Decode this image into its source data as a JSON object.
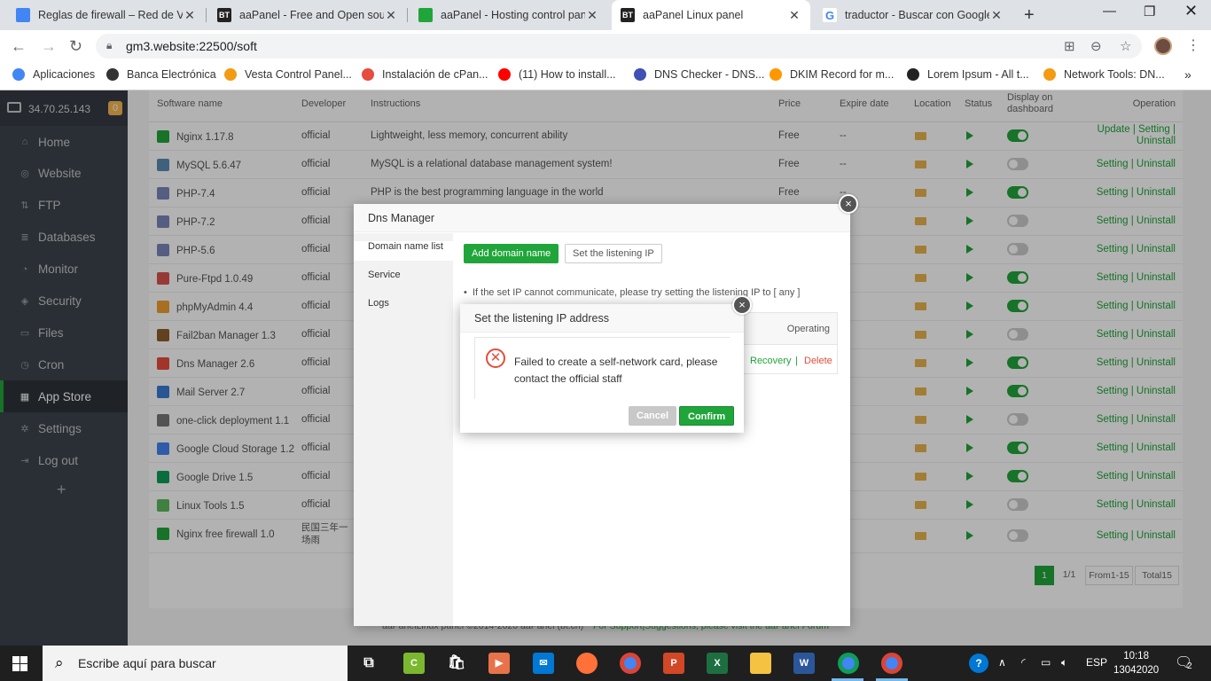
{
  "browser": {
    "tabs": [
      {
        "title": "Reglas de firewall – Red de VPC",
        "favicon_color": "#4285f4",
        "favicon_text": "",
        "active": false
      },
      {
        "title": "aaPanel - Free and Open source",
        "favicon_color": "#222222",
        "favicon_text": "BT",
        "active": false
      },
      {
        "title": "aaPanel - Hosting control panel",
        "favicon_color": "#20a53a",
        "favicon_text": "",
        "active": false
      },
      {
        "title": "aaPanel Linux panel",
        "favicon_color": "#222222",
        "favicon_text": "BT",
        "active": true
      },
      {
        "title": "traductor - Buscar con Google",
        "favicon_color": "#ffffff",
        "favicon_text": "G",
        "active": false
      }
    ],
    "url": "gm3.website:22500/soft",
    "bookmarks": [
      {
        "label": "Aplicaciones",
        "color": "#4285f4"
      },
      {
        "label": "Banca Electrónica",
        "color": "#333333"
      },
      {
        "label": "Vesta Control Panel...",
        "color": "#f39c12"
      },
      {
        "label": "Instalación de cPan...",
        "color": "#e74c3c"
      },
      {
        "label": "(11) How to install...",
        "color": "#ff0000"
      },
      {
        "label": "DNS Checker - DNS...",
        "color": "#3f51b5"
      },
      {
        "label": "DKIM Record for m...",
        "color": "#ff9800"
      },
      {
        "label": "Lorem Ipsum - All t...",
        "color": "#222222"
      },
      {
        "label": "Network Tools: DN...",
        "color": "#f39c12"
      }
    ]
  },
  "sidebar": {
    "ip": "34.70.25.143",
    "badge": "0",
    "items": [
      {
        "label": "Home",
        "icon": "home-icon",
        "glyph": "⌂"
      },
      {
        "label": "Website",
        "icon": "globe-icon",
        "glyph": "◎"
      },
      {
        "label": "FTP",
        "icon": "ftp-icon",
        "glyph": "⇅"
      },
      {
        "label": "Databases",
        "icon": "database-icon",
        "glyph": "≣"
      },
      {
        "label": "Monitor",
        "icon": "monitor-icon",
        "glyph": "◔"
      },
      {
        "label": "Security",
        "icon": "shield-icon",
        "glyph": "◈"
      },
      {
        "label": "Files",
        "icon": "folder-icon",
        "glyph": "▭"
      },
      {
        "label": "Cron",
        "icon": "clock-icon",
        "glyph": "◷"
      },
      {
        "label": "App Store",
        "icon": "grid-icon",
        "glyph": "▦"
      },
      {
        "label": "Settings",
        "icon": "gear-icon",
        "glyph": "✲"
      },
      {
        "label": "Log out",
        "icon": "logout-icon",
        "glyph": "⇥"
      }
    ],
    "active_index": 8,
    "add_label": "+"
  },
  "table": {
    "headers": {
      "name": "Software name",
      "developer": "Developer",
      "instructions": "Instructions",
      "price": "Price",
      "expire": "Expire date",
      "location": "Location",
      "status": "Status",
      "display": "Display on dashboard",
      "operation": "Operation"
    },
    "rows": [
      {
        "name": "Nginx 1.17.8",
        "developer": "official",
        "instructions": "Lightweight, less memory, concurrent ability",
        "price": "Free",
        "expire": "--",
        "display_on": true,
        "ops": "Update | Setting | Uninstall",
        "icon_color": "#20a53a"
      },
      {
        "name": "MySQL 5.6.47",
        "developer": "official",
        "instructions": "MySQL is a relational database management system!",
        "price": "Free",
        "expire": "--",
        "display_on": false,
        "ops": "Setting | Uninstall",
        "icon_color": "#5b8bb5"
      },
      {
        "name": "PHP-7.4",
        "developer": "official",
        "instructions": "PHP is the best programming language in the world",
        "price": "Free",
        "expire": "--",
        "display_on": true,
        "ops": "Setting | Uninstall",
        "icon_color": "#7a86b8"
      },
      {
        "name": "PHP-7.2",
        "developer": "official",
        "instructions": "",
        "price": "",
        "expire": "",
        "display_on": false,
        "ops": "Setting | Uninstall",
        "icon_color": "#7a86b8"
      },
      {
        "name": "PHP-5.6",
        "developer": "official",
        "instructions": "",
        "price": "",
        "expire": "",
        "display_on": false,
        "ops": "Setting | Uninstall",
        "icon_color": "#7a86b8"
      },
      {
        "name": "Pure-Ftpd 1.0.49",
        "developer": "official",
        "instructions": "",
        "price": "",
        "expire": "",
        "display_on": true,
        "ops": "Setting | Uninstall",
        "icon_color": "#d9534f"
      },
      {
        "name": "phpMyAdmin 4.4",
        "developer": "official",
        "instructions": "",
        "price": "",
        "expire": "",
        "display_on": true,
        "ops": "Setting | Uninstall",
        "icon_color": "#f0a030"
      },
      {
        "name": "Fail2ban Manager 1.3",
        "developer": "official",
        "instructions": "",
        "price": "",
        "expire": "",
        "display_on": false,
        "ops": "Setting | Uninstall",
        "icon_color": "#8b5e2b"
      },
      {
        "name": "Dns Manager 2.6",
        "developer": "official",
        "instructions": "",
        "price": "",
        "expire": "",
        "display_on": true,
        "ops": "Setting | Uninstall",
        "icon_color": "#e74c3c"
      },
      {
        "name": "Mail Server 2.7",
        "developer": "official",
        "instructions": "",
        "price": "",
        "expire": "",
        "display_on": true,
        "ops": "Setting | Uninstall",
        "icon_color": "#3a7bd5"
      },
      {
        "name": "one-click deployment 1.1",
        "developer": "official",
        "instructions": "",
        "price": "",
        "expire": "",
        "display_on": false,
        "ops": "Setting | Uninstall",
        "icon_color": "#777777"
      },
      {
        "name": "Google Cloud Storage 1.2",
        "developer": "official",
        "instructions": "",
        "price": "",
        "expire": "",
        "display_on": true,
        "ops": "Setting | Uninstall",
        "icon_color": "#4285f4"
      },
      {
        "name": "Google Drive 1.5",
        "developer": "official",
        "instructions": "",
        "price": "",
        "expire": "",
        "display_on": true,
        "ops": "Setting | Uninstall",
        "icon_color": "#0f9d58"
      },
      {
        "name": "Linux Tools 1.5",
        "developer": "official",
        "instructions": "",
        "price": "",
        "expire": "",
        "display_on": false,
        "ops": "Setting | Uninstall",
        "icon_color": "#5cb85c"
      },
      {
        "name": "Nginx free firewall 1.0",
        "developer": "民国三年一场雨",
        "instructions": "",
        "price": "",
        "expire": "",
        "display_on": false,
        "ops": "Setting | Uninstall",
        "icon_color": "#20a53a"
      }
    ],
    "pager": {
      "current": "1",
      "pages": "1/1",
      "range": "From1-15",
      "total": "Total15"
    }
  },
  "footer": {
    "copyright": "aaPanelLinux panel ©2014-2020 aaPanel (bt.cn)",
    "support": "For Support|Suggestions, please visit the aaPanel Forum"
  },
  "dns_dialog": {
    "title": "Dns Manager",
    "side_items": [
      "Domain name list",
      "Service",
      "Logs"
    ],
    "add_button": "Add domain name",
    "listen_button": "Set the listening IP",
    "hint": "If the set IP cannot communicate, please try setting the listening IP to [ any ]",
    "operating_header": "Operating",
    "recovery": "Recovery",
    "delete": "Delete",
    "close": "×"
  },
  "alert_dialog": {
    "title": "Set the listening IP address",
    "message": "Failed to create a self-network card, please contact the official staff",
    "cancel": "Cancel",
    "confirm": "Confirm",
    "close": "×"
  },
  "taskbar": {
    "search_placeholder": "Escribe aquí para buscar",
    "language": "ESP",
    "time": "10:18",
    "date": "13042020",
    "notifications": "2"
  },
  "colors": {
    "accent": "#20a53a",
    "sidebar": "#3c444d",
    "error": "#e74c3c"
  }
}
